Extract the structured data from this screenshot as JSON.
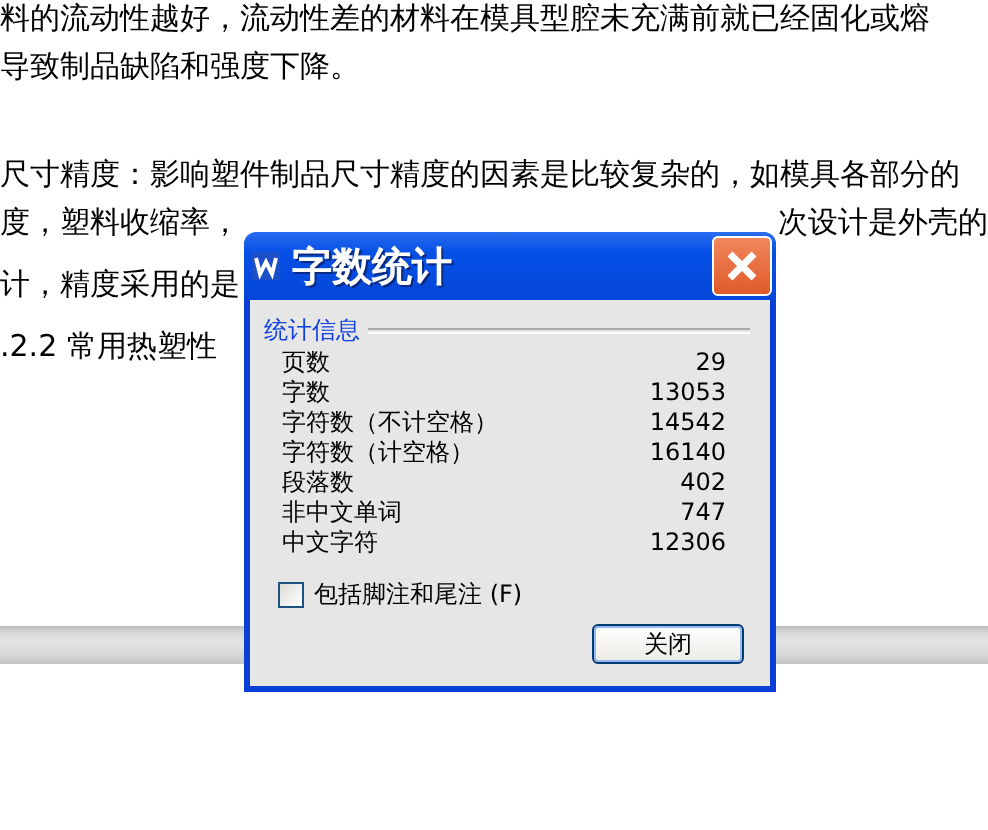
{
  "document": {
    "paragraphs": [
      {
        "lines": [
          {
            "text": "料的流动性越好，流动性差的材料在模具型腔未充满前就已经固化或熔"
          },
          {
            "text": "导致制品缺陷和强度下降。"
          }
        ]
      },
      {
        "lines": [
          {
            "text": "尺寸精度：影响塑件制品尺寸精度的因素是比较复杂的，如模具各部分的"
          },
          {
            "text": "度，塑料收缩率，",
            "text_after_dialog": "次设计是外壳的"
          },
          {
            "text": "计，精度采用的是"
          },
          {
            "text": ".2.2 常用热塑性"
          }
        ]
      }
    ]
  },
  "dialog": {
    "title": "字数统计",
    "group_label": "统计信息",
    "stats": [
      {
        "label": "页数",
        "value": "29"
      },
      {
        "label": "字数",
        "value": "13053"
      },
      {
        "label": "字符数（不计空格）",
        "value": "14542"
      },
      {
        "label": "字符数（计空格）",
        "value": "16140"
      },
      {
        "label": "段落数",
        "value": "402"
      },
      {
        "label": "非中文单词",
        "value": "747"
      },
      {
        "label": "中文字符",
        "value": "12306"
      }
    ],
    "checkbox": {
      "label": "包括脚注和尾注 (F)",
      "checked": false
    },
    "buttons": [
      "关闭"
    ]
  }
}
